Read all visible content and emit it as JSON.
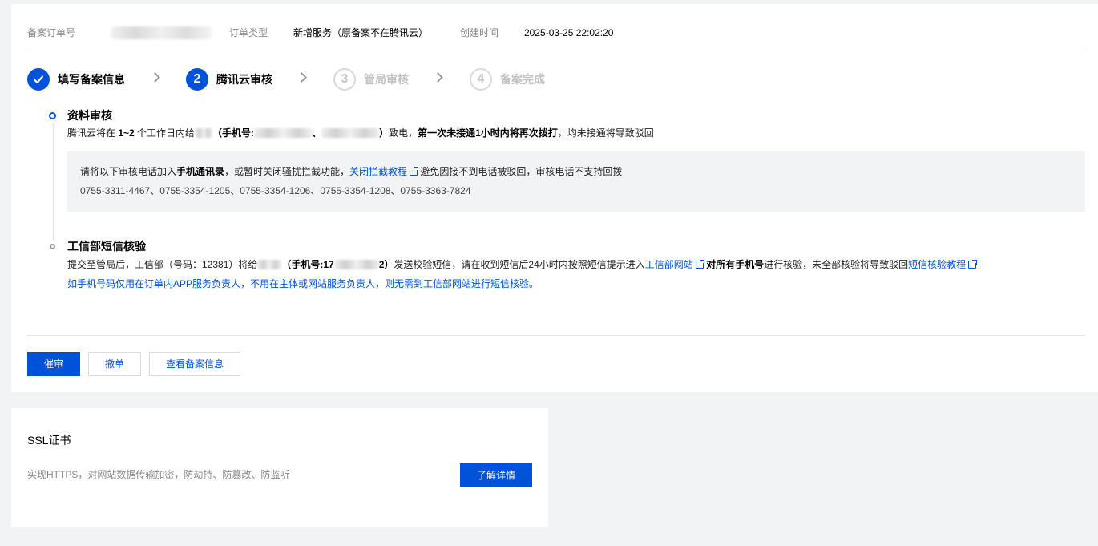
{
  "order_info": {
    "order_no_label": "备案订单号",
    "order_type_label": "订单类型",
    "order_type_value": "新增服务（原备案不在腾讯云）",
    "created_label": "创建时间",
    "created_value": "2025-03-25 22:02:20"
  },
  "steps": [
    {
      "number": "1",
      "label": "填写备案信息",
      "state": "done"
    },
    {
      "number": "2",
      "label": "腾讯云审核",
      "state": "active"
    },
    {
      "number": "3",
      "label": "管局审核",
      "state": "todo"
    },
    {
      "number": "4",
      "label": "备案完成",
      "state": "todo"
    }
  ],
  "review": {
    "title": "资料审核",
    "desc_prefix": "腾讯云将在 ",
    "desc_days": "1~2",
    "desc_mid": " 个工作日内给",
    "desc_phone_label": "（手机号:",
    "desc_phone_sep": "、",
    "desc_phone_end": "）",
    "desc_call": "致电，",
    "desc_bold": "第一次未接通1小时内将再次拨打",
    "desc_tail": "，均未接通将导致驳回",
    "notice_prefix": "请将以下审核电话加入",
    "notice_bold": "手机通讯录",
    "notice_mid": "，或暂时关闭骚扰拦截功能，",
    "notice_link": "关闭拦截教程",
    "notice_tail": "避免因接不到电话被驳回，审核电话不支持回拨",
    "phones": "0755-3311-4467、0755-3354-1205、0755-3354-1206、0755-3354-1208、0755-3363-7824"
  },
  "sms": {
    "title": "工信部短信核验",
    "line1_prefix": "提交至管局后，工信部（号码：12381）将给",
    "line1_phone_label": "（手机号:17",
    "line1_phone_end": "2）",
    "line1_mid": "发送校验短信，请在收到短信后24小时内按照短信提示进入",
    "line1_link1": "工信部网站",
    "line1_bold": "对所有手机号",
    "line1_tail": "进行核验，未全部核验将导致驳回",
    "line1_link2": "短信核验教程",
    "line2": "如手机号码仅用在订单内APP服务负责人，不用在主体或网站服务负责人，则无需到工信部网站进行短信核验。"
  },
  "actions": {
    "urge": "催审",
    "withdraw": "撤单",
    "view": "查看备案信息"
  },
  "ssl": {
    "title": "SSL证书",
    "desc": "实现HTTPS，对网站数据传输加密，防劫持、防篡改、防监听",
    "button": "了解详情"
  },
  "colors": {
    "primary": "#0052d9",
    "background": "#f2f3f5"
  }
}
